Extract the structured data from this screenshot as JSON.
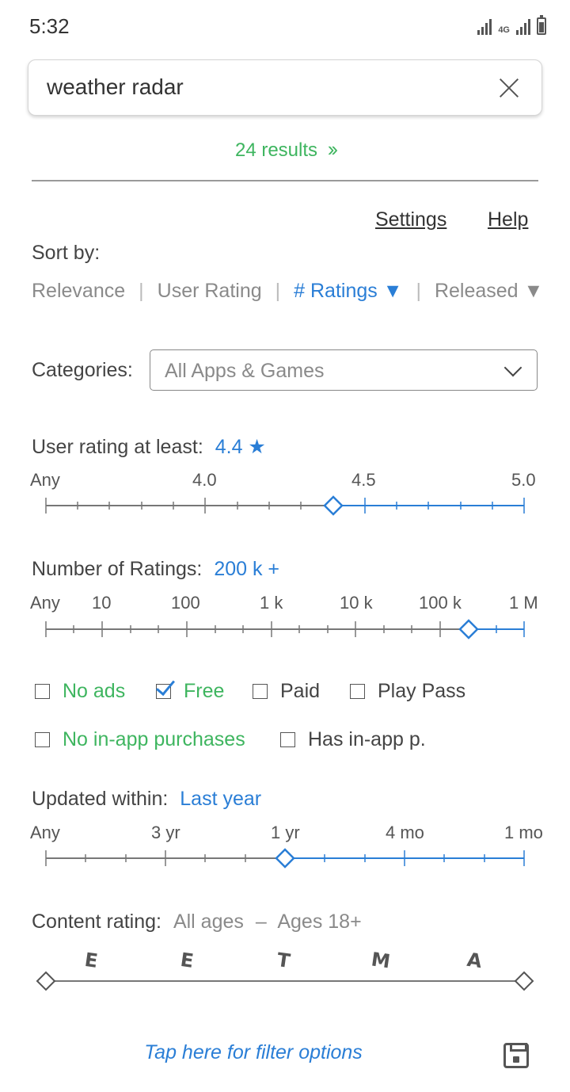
{
  "status_bar": {
    "time": "5:32",
    "network_label": "4G"
  },
  "search": {
    "query": "weather radar",
    "clear_icon": "close-icon"
  },
  "results": {
    "count_text": "24  results",
    "arrows": "››"
  },
  "links": {
    "settings": "Settings",
    "help": "Help"
  },
  "sort": {
    "label": "Sort by:",
    "options": [
      "Relevance",
      "User Rating",
      "# Ratings ▼",
      "Released ▼"
    ],
    "active_index": 2
  },
  "categories": {
    "label": "Categories:",
    "selected": "All Apps & Games"
  },
  "user_rating": {
    "label": "User rating at least:",
    "value": "4.4 ★",
    "ticks": [
      "Any",
      "4.0",
      "4.5",
      "5.0"
    ],
    "selected_value": 4.4
  },
  "num_ratings": {
    "label": "Number of Ratings:",
    "value": "200 k +",
    "ticks": [
      "Any",
      "10",
      "100",
      "1 k",
      "10 k",
      "100 k",
      "1 M"
    ],
    "selected_value": "200 k"
  },
  "filters_row1": [
    {
      "label": "No ads",
      "checked": false,
      "color": "#3eb55f"
    },
    {
      "label": "Free",
      "checked": true,
      "color": "#3eb55f"
    },
    {
      "label": "Paid",
      "checked": false,
      "color": "#444444"
    },
    {
      "label": "Play Pass",
      "checked": false,
      "color": "#444444"
    }
  ],
  "filters_row2": [
    {
      "label": "No in-app purchases",
      "checked": false,
      "color": "#3eb55f"
    },
    {
      "label": "Has in-app p.",
      "checked": false,
      "color": "#444444"
    }
  ],
  "updated": {
    "label": "Updated within:",
    "value": "Last year",
    "ticks": [
      "Any",
      "3 yr",
      "1 yr",
      "4 mo",
      "1 mo"
    ],
    "selected_value": "1 yr"
  },
  "content_rating": {
    "label": "Content rating:",
    "value_from": "All ages",
    "dash": "–",
    "value_to": "Ages 18+",
    "letters": [
      "E",
      "E",
      "T",
      "M",
      "A"
    ]
  },
  "footer": {
    "filter_link": "Tap here for filter options",
    "save_icon": "save-icon"
  },
  "colors": {
    "accent_blue": "#2a7ed6",
    "accent_green": "#3eb55f",
    "track_grey": "#777777"
  }
}
